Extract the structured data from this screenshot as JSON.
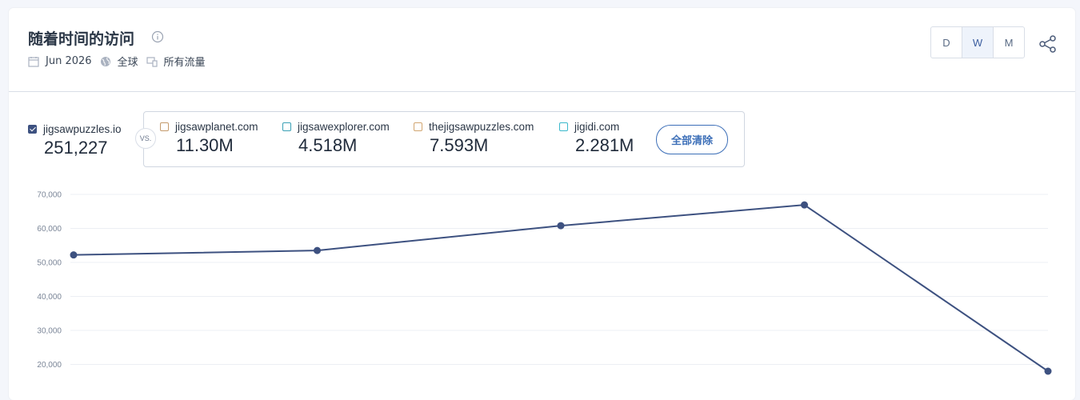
{
  "header": {
    "title": "随着时间的访问",
    "date": "Jun 2026",
    "region": "全球",
    "traffic": "所有流量"
  },
  "period": {
    "options": [
      "D",
      "W",
      "M"
    ],
    "active": "W"
  },
  "primary": {
    "site": "jigsawpuzzles.io",
    "value": "251,227",
    "color": "#3d5180"
  },
  "vs_label": "VS.",
  "competitors": [
    {
      "site": "jigsawplanet.com",
      "value": "11.30M",
      "color": "#c49a6c"
    },
    {
      "site": "jigsawexplorer.com",
      "value": "4.518M",
      "color": "#3aa0b5"
    },
    {
      "site": "thejigsawpuzzles.com",
      "value": "7.593M",
      "color": "#d1a570"
    },
    {
      "site": "jigidi.com",
      "value": "2.281M",
      "color": "#3ab8cc"
    }
  ],
  "clear_all": "全部清除",
  "chart_data": {
    "type": "line",
    "y_ticks": [
      "70,000",
      "60,000",
      "50,000",
      "40,000",
      "30,000",
      "20,000"
    ],
    "ylim": [
      20000,
      70000
    ],
    "grid": true,
    "series": [
      {
        "name": "jigsawpuzzles.io",
        "color": "#3d5180",
        "values": [
          52200,
          53500,
          60800,
          66900,
          18000
        ]
      }
    ]
  }
}
